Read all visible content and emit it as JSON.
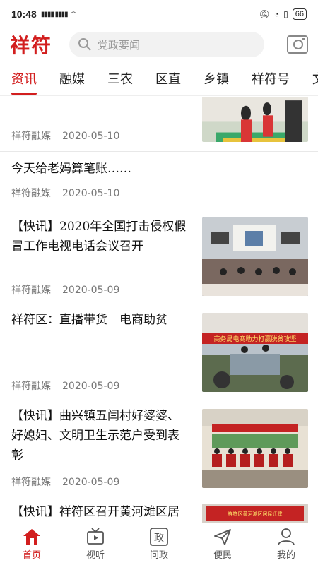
{
  "status_bar": {
    "time": "10:48",
    "battery": "66"
  },
  "header": {
    "logo": "祥符",
    "search_placeholder": "党政要闻",
    "camera_icon": "camera-icon"
  },
  "tabs": [
    {
      "label": "资讯",
      "active": true
    },
    {
      "label": "融媒"
    },
    {
      "label": "三农"
    },
    {
      "label": "区直"
    },
    {
      "label": "乡镇"
    },
    {
      "label": "祥符号"
    },
    {
      "label": "文化"
    }
  ],
  "feed": [
    {
      "title": "",
      "source": "祥符融媒",
      "date": "2020-05-10"
    },
    {
      "title": "今天给老妈算笔账……",
      "source": "祥符融媒",
      "date": "2020-05-10"
    },
    {
      "title_lines": [
        "【快讯】2020年全国打击侵权假",
        "冒工作电视电话会议召开"
      ],
      "source": "祥符融媒",
      "date": "2020-05-09"
    },
    {
      "title": "祥符区：直播带货　电商助贫",
      "source": "祥符融媒",
      "date": "2020-05-09",
      "image_text": "商务局电商助力打赢脱贫攻坚"
    },
    {
      "title_lines": [
        "【快讯】曲兴镇五闫村好婆婆、",
        "好媳妇、文明卫生示范户受到表",
        "彰"
      ],
      "source": "祥符融媒",
      "date": "2020-05-09"
    },
    {
      "title": "【快讯】祥符区召开黄河滩区居",
      "image_text": "祥符区黄河滩区居民迁建"
    }
  ],
  "bottom_nav": [
    {
      "label": "首页",
      "icon": "home-icon",
      "active": true
    },
    {
      "label": "视听",
      "icon": "tv-icon"
    },
    {
      "label": "问政",
      "icon": "zheng-icon",
      "glyph": "政"
    },
    {
      "label": "便民",
      "icon": "send-icon"
    },
    {
      "label": "我的",
      "icon": "user-icon"
    }
  ],
  "colors": {
    "brand": "#d21e1e",
    "text": "#111111",
    "meta": "#777777"
  }
}
